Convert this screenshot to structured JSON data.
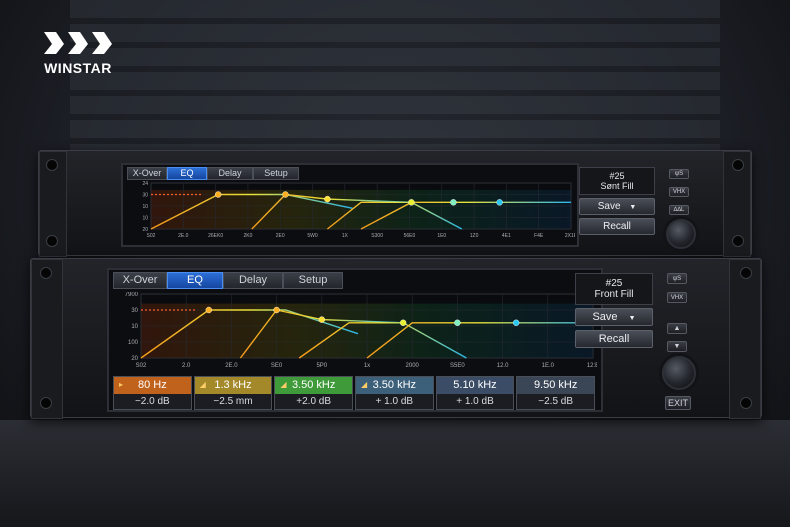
{
  "brand": {
    "name": "WINSTAR"
  },
  "top_unit": {
    "tabs": [
      "X-Over",
      "EQ",
      "Delay",
      "Setup"
    ],
    "active_tab": 1,
    "preset_number": "#25",
    "preset_name": "Sønt Fill",
    "save_label": "Save",
    "save_arrow": "▼",
    "recall_label": "Recall",
    "side_buttons": [
      "ψS",
      "VHX",
      "∆∆L"
    ],
    "y_ticks": [
      "24",
      "30",
      "10",
      "10",
      "20"
    ],
    "x_ticks": [
      "S02",
      "2E.0",
      "26EK0",
      "2K0",
      "2E0",
      "5W0",
      "1X",
      "S300",
      "56E0",
      "1E0",
      "1Z0",
      "4E1",
      "F4E",
      "2X1E"
    ]
  },
  "bottom_unit": {
    "tabs": [
      "X-Over",
      "EQ",
      "Delay",
      "Setup"
    ],
    "active_tab": 1,
    "preset_number": "#25",
    "preset_name": "Front Fill",
    "save_label": "Save",
    "save_arrow": "▼",
    "recall_label": "Recall",
    "side_buttons": [
      "ψS",
      "VHX",
      "▲",
      "▼"
    ],
    "exit_label": "EXIT",
    "y_ticks": [
      "7900",
      "30",
      "10",
      "100",
      "20"
    ],
    "x_ticks": [
      "S02",
      "2.0",
      "2E.0",
      "SE0",
      "5P0",
      "1x",
      "2000",
      "S5E0",
      "12.0",
      "1E.0",
      "12:B"
    ],
    "bands": [
      {
        "freq": "80 Hz",
        "gain": "−2.0 dB",
        "color": "#c0611c",
        "marker": "▸"
      },
      {
        "freq": "1.3 kHz",
        "gain": "−2.5 mm",
        "color": "#a3892a",
        "marker": "◢"
      },
      {
        "freq": "3.50 kHz",
        "gain": "+2.0 dB",
        "color": "#3f9a3a",
        "marker": "◢"
      },
      {
        "freq": "3.50 kHz",
        "gain": "+ 1.0 dB",
        "color": "#3c5f7a",
        "marker": "◢"
      },
      {
        "freq": "5.10 kHz",
        "gain": "+ 1.0 dB",
        "color": "#3b4d66",
        "marker": ""
      },
      {
        "freq": "9.50 kHz",
        "gain": "−2.5 dB",
        "color": "#3a4556",
        "marker": ""
      }
    ]
  },
  "colors": {
    "accent_blue": "#2c6fd6",
    "curve_start": "#f59a1a",
    "curve_mid": "#e8e23a",
    "curve_end": "#2ab7e8"
  }
}
